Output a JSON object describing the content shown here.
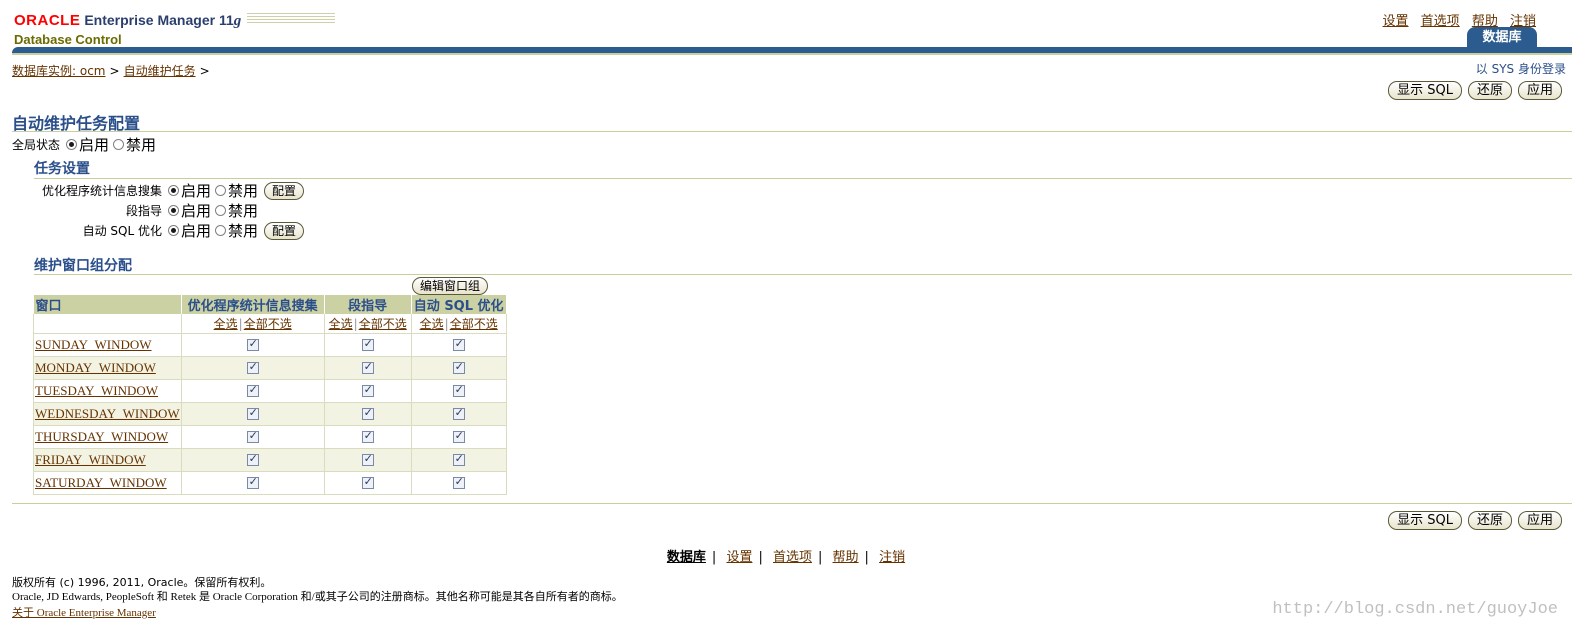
{
  "header": {
    "oracle": "ORACLE",
    "product": "Enterprise Manager 11",
    "version": "g",
    "subtitle": "Database Control",
    "global_links": [
      "设置",
      "首选项",
      "帮助",
      "注销"
    ],
    "tab": "数据库"
  },
  "breadcrumb": {
    "items": [
      "数据库实例: ocm",
      "自动维护任务"
    ],
    "sep": ">"
  },
  "login_as": "以 SYS 身份登录",
  "buttons": {
    "show_sql": "显示 SQL",
    "revert": "还原",
    "apply": "应用",
    "configure": "配置",
    "edit_window_group": "编辑窗口组"
  },
  "page_title": "自动维护任务配置",
  "global_status": {
    "label": "全局状态",
    "enable": "启用",
    "disable": "禁用",
    "selected": "启用"
  },
  "task_settings": {
    "title": "任务设置",
    "tasks": [
      {
        "label": "优化程序统计信息搜集",
        "enable": "启用",
        "disable": "禁用",
        "selected": "启用",
        "has_config": true
      },
      {
        "label": "段指导",
        "enable": "启用",
        "disable": "禁用",
        "selected": "启用",
        "has_config": false
      },
      {
        "label": "自动 SQL 优化",
        "enable": "启用",
        "disable": "禁用",
        "selected": "启用",
        "has_config": true
      }
    ]
  },
  "window_group": {
    "title": "维护窗口组分配",
    "columns": [
      "窗口",
      "优化程序统计信息搜集",
      "段指导",
      "自动 SQL 优化"
    ],
    "select_all": "全选",
    "deselect_all": "全部不选",
    "rows": [
      {
        "name": "SUNDAY_WINDOW",
        "checks": [
          true,
          true,
          true
        ]
      },
      {
        "name": "MONDAY_WINDOW",
        "checks": [
          true,
          true,
          true
        ]
      },
      {
        "name": "TUESDAY_WINDOW",
        "checks": [
          true,
          true,
          true
        ]
      },
      {
        "name": "WEDNESDAY_WINDOW",
        "checks": [
          true,
          true,
          true
        ]
      },
      {
        "name": "THURSDAY_WINDOW",
        "checks": [
          true,
          true,
          true
        ]
      },
      {
        "name": "FRIDAY_WINDOW",
        "checks": [
          true,
          true,
          true
        ]
      },
      {
        "name": "SATURDAY_WINDOW",
        "checks": [
          true,
          true,
          true
        ]
      }
    ]
  },
  "footer": {
    "links": [
      "数据库",
      "设置",
      "首选项",
      "帮助",
      "注销"
    ],
    "current": "数据库",
    "copyright": "版权所有 (c) 1996, 2011, Oracle。保留所有权利。",
    "trademark": "Oracle, JD Edwards, PeopleSoft 和 Retek 是 Oracle Corporation 和/或其子公司的注册商标。其他名称可能是其各自所有者的商标。",
    "about": "关于 Oracle Enterprise Manager"
  },
  "watermark": "http://blog.csdn.net/guoyJoe",
  "colors": {
    "accent": "#2b5b8f",
    "heading": "#2b4f8a",
    "table_header": "#ccd1a4",
    "link": "#663300"
  }
}
